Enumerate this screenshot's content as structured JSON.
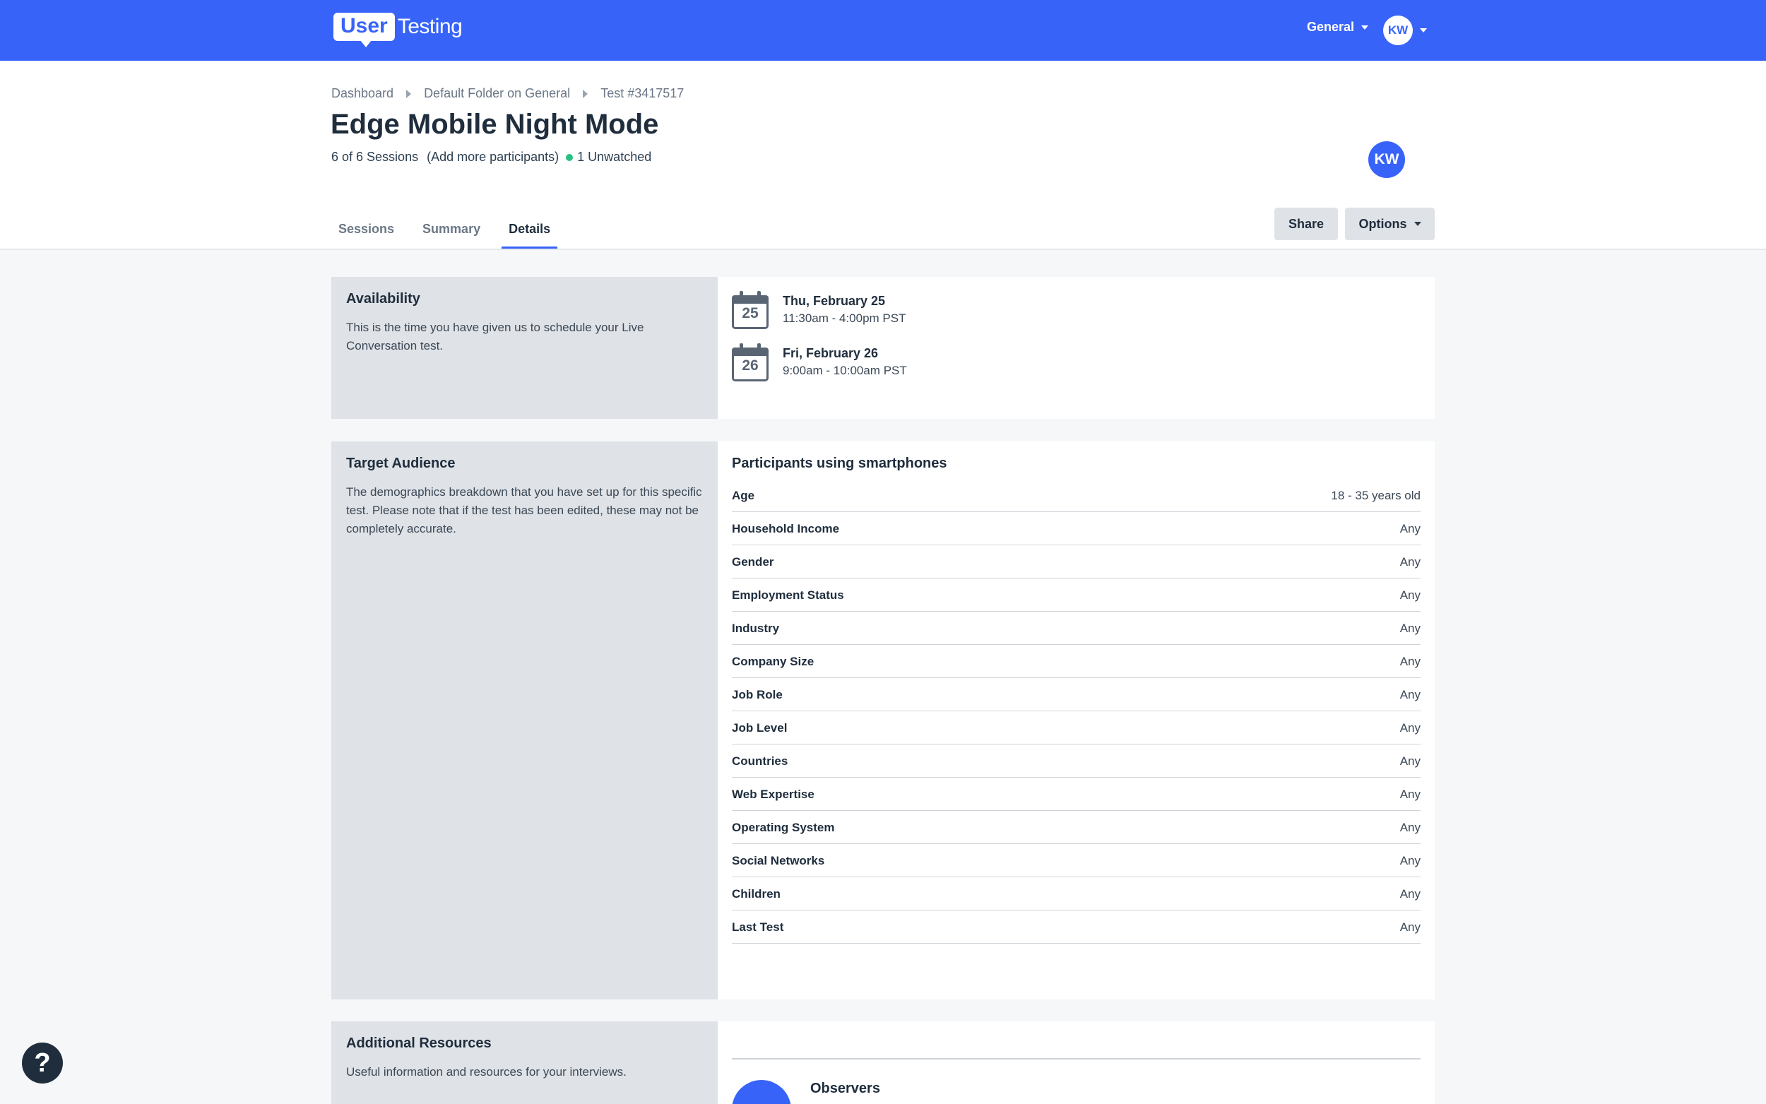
{
  "brand": {
    "logo_user": "User",
    "logo_testing": "Testing"
  },
  "topnav": {
    "workspace": "General",
    "avatar_initials": "KW"
  },
  "breadcrumb": [
    "Dashboard",
    "Default Folder on General",
    "Test #3417517"
  ],
  "test": {
    "title": "Edge Mobile Night Mode",
    "sessions": "6 of 6 Sessions",
    "add_participants": "(Add more participants)",
    "unwatched": "1 Unwatched",
    "owner_initials": "KW"
  },
  "tabs": [
    {
      "label": "Sessions",
      "active": false
    },
    {
      "label": "Summary",
      "active": false
    },
    {
      "label": "Details",
      "active": true
    }
  ],
  "actions": {
    "share": "Share",
    "options": "Options"
  },
  "availability": {
    "title": "Availability",
    "description": "This is the time you have given us to schedule your Live Conversation test.",
    "slots": [
      {
        "day_num": "25",
        "date": "Thu, February 25",
        "time": "11:30am - 4:00pm PST"
      },
      {
        "day_num": "26",
        "date": "Fri, February 26",
        "time": "9:00am - 10:00am PST"
      }
    ]
  },
  "audience": {
    "title": "Target Audience",
    "description": "The demographics breakdown that you have set up for this specific test. Please note that if the test has been edited, these may not be completely accurate.",
    "heading": "Participants using smartphones",
    "rows": [
      {
        "label": "Age",
        "value": "18 - 35 years old"
      },
      {
        "label": "Household Income",
        "value": "Any"
      },
      {
        "label": "Gender",
        "value": "Any"
      },
      {
        "label": "Employment Status",
        "value": "Any"
      },
      {
        "label": "Industry",
        "value": "Any"
      },
      {
        "label": "Company Size",
        "value": "Any"
      },
      {
        "label": "Job Role",
        "value": "Any"
      },
      {
        "label": "Job Level",
        "value": "Any"
      },
      {
        "label": "Countries",
        "value": "Any"
      },
      {
        "label": "Web Expertise",
        "value": "Any"
      },
      {
        "label": "Operating System",
        "value": "Any"
      },
      {
        "label": "Social Networks",
        "value": "Any"
      },
      {
        "label": "Children",
        "value": "Any"
      },
      {
        "label": "Last Test",
        "value": "Any"
      }
    ]
  },
  "resources": {
    "title": "Additional Resources",
    "description": "Useful information and resources for your interviews.",
    "observers_title": "Observers"
  },
  "help": {
    "glyph": "?"
  }
}
